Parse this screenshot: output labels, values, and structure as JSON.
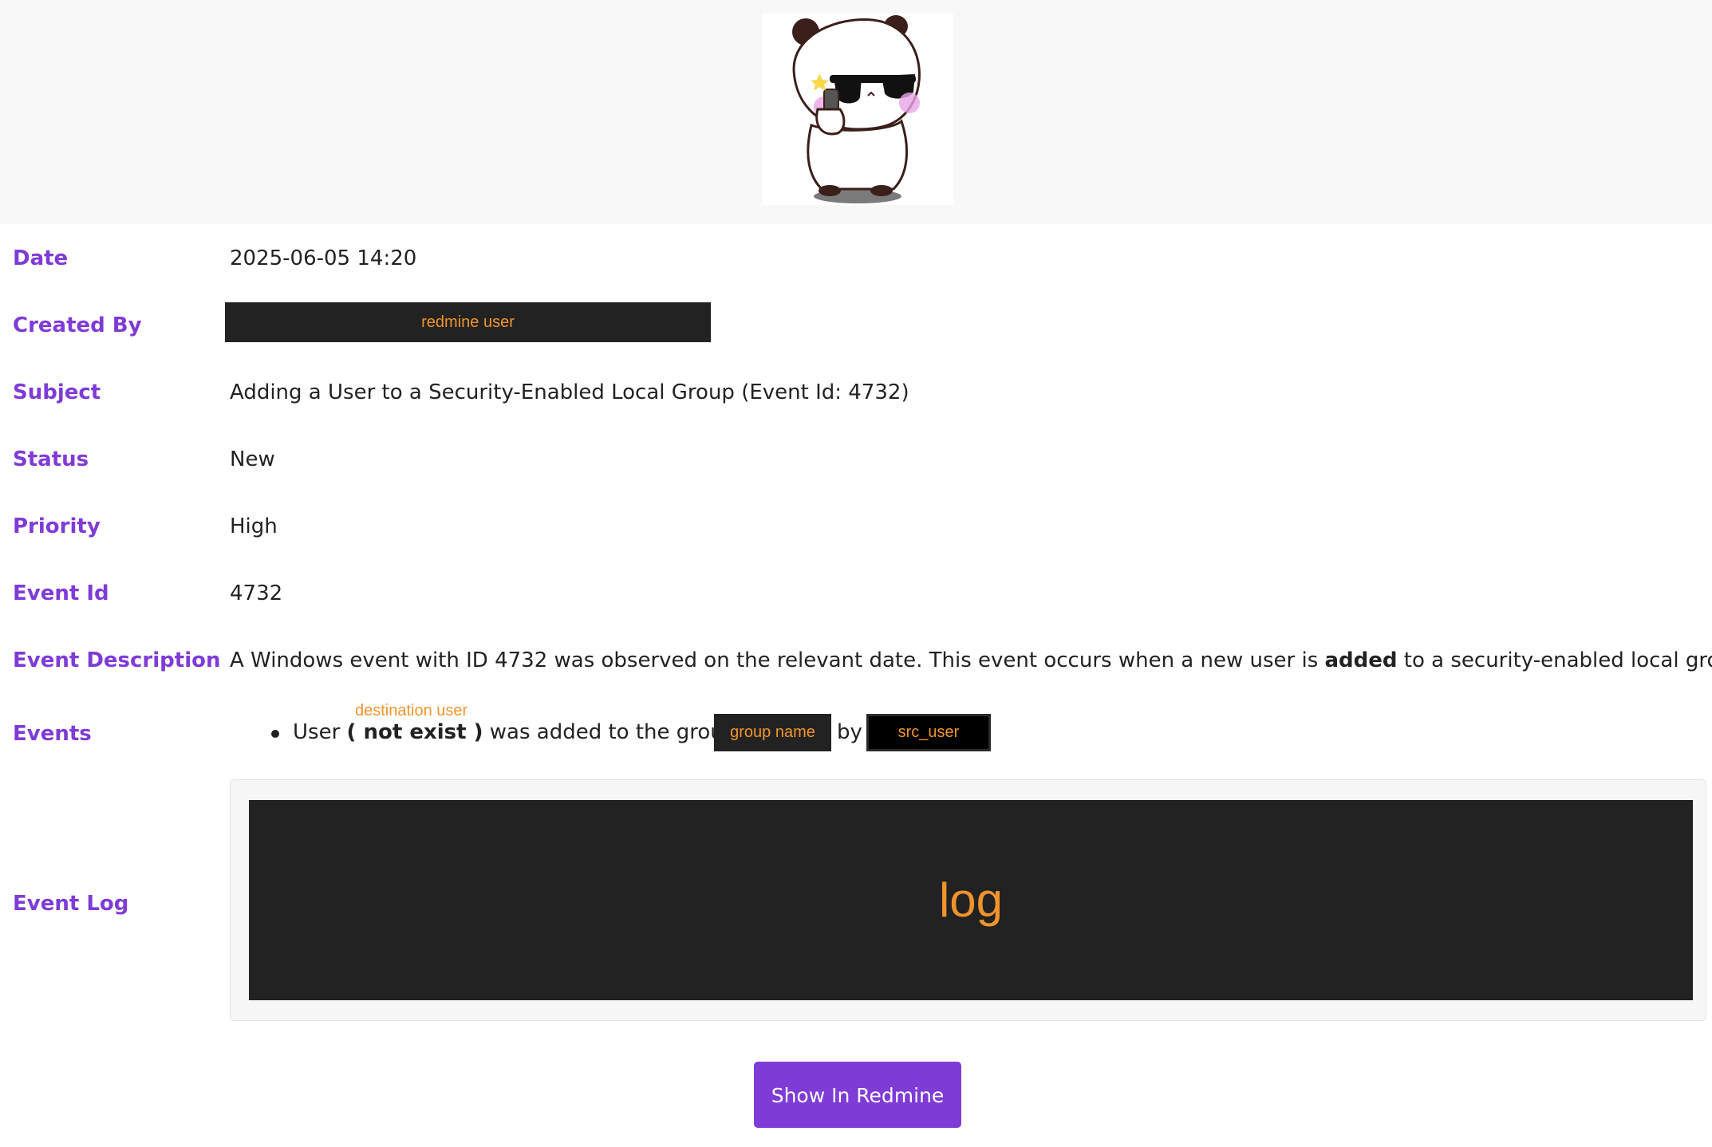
{
  "header": {
    "avatar_icon": "panda-with-sunglasses-icon"
  },
  "fields": {
    "date": {
      "label": "Date",
      "value": "2025-06-05 14:20"
    },
    "created_by": {
      "label": "Created By",
      "value": "redmine user"
    },
    "subject": {
      "label": "Subject",
      "value": "Adding a User to a Security-Enabled Local Group (Event Id: 4732)"
    },
    "status": {
      "label": "Status",
      "value": "New"
    },
    "priority": {
      "label": "Priority",
      "value": "High"
    },
    "event_id": {
      "label": "Event Id",
      "value": "4732"
    },
    "event_description": {
      "label": "Event Description",
      "text_before": "A Windows event with ID 4732 was observed on the relevant date. This event occurs when a new user is ",
      "bold": "added",
      "text_after": " to a security-enabled local group."
    },
    "events": {
      "label": "Events",
      "dest_note": "destination user",
      "prefix": "User ",
      "not_exist": "( not exist )",
      "middle": " was added to the group ",
      "group_name": "group name",
      "by": " by ",
      "src_user": "src_user"
    },
    "event_log": {
      "label": "Event Log",
      "value": "log"
    }
  },
  "actions": {
    "show_in_redmine": "Show In Redmine"
  },
  "colors": {
    "accent": "#7f3bd6",
    "redact_text": "#f2942c",
    "redact_bg": "#222222"
  }
}
